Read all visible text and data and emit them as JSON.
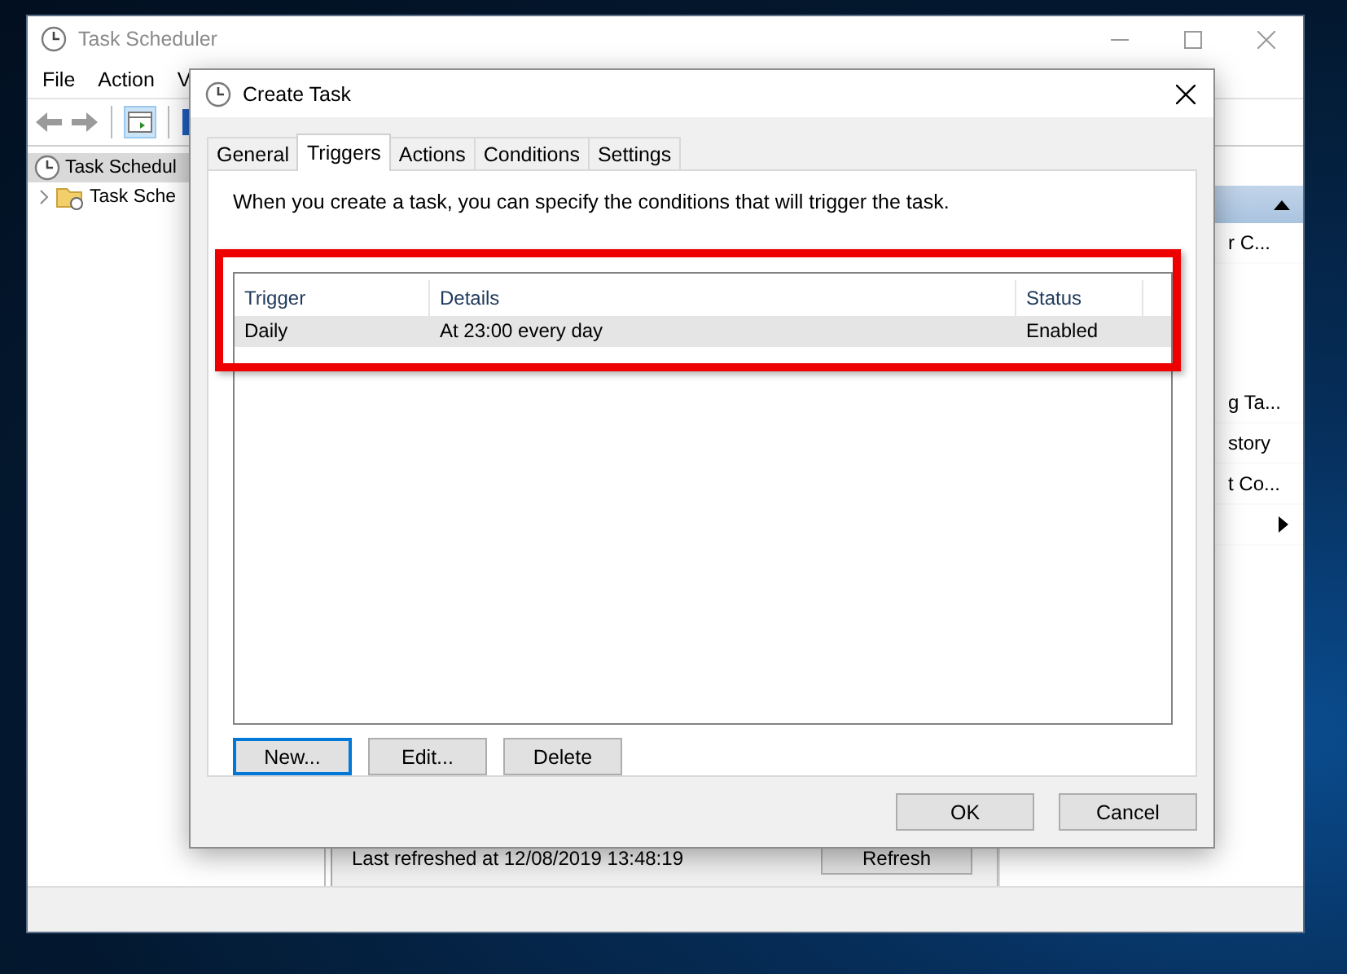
{
  "main_window": {
    "title": "Task Scheduler",
    "menu": [
      "File",
      "Action",
      "V"
    ],
    "tree": [
      {
        "label": "Task Schedul",
        "selected": true,
        "children": [
          {
            "label": "Task Sche",
            "selected": false
          }
        ]
      }
    ],
    "status_text": "Last refreshed at 12/08/2019 13:48:19",
    "refresh_button": "Refresh",
    "actions_pane": [
      {
        "kind": "text",
        "label": "r C..."
      },
      {
        "kind": "text",
        "label": "g Ta..."
      },
      {
        "kind": "text",
        "label": "story"
      },
      {
        "kind": "text",
        "label": "t Co..."
      },
      {
        "kind": "submenu"
      }
    ]
  },
  "dialog": {
    "title": "Create Task",
    "tabs": [
      {
        "label": "General",
        "selected": false
      },
      {
        "label": "Triggers",
        "selected": true
      },
      {
        "label": "Actions",
        "selected": false
      },
      {
        "label": "Conditions",
        "selected": false
      },
      {
        "label": "Settings",
        "selected": false
      }
    ],
    "description": "When you create a task, you can specify the conditions that will trigger the task.",
    "table": {
      "columns": [
        "Trigger",
        "Details",
        "Status"
      ],
      "rows": [
        {
          "cells": [
            "Daily",
            "At 23:00 every day",
            "Enabled"
          ],
          "selected": true
        }
      ]
    },
    "list_buttons": [
      {
        "label": "New...",
        "focused": true
      },
      {
        "label": "Edit...",
        "focused": false
      },
      {
        "label": "Delete",
        "focused": false
      }
    ],
    "buttons": [
      "OK",
      "Cancel"
    ]
  }
}
